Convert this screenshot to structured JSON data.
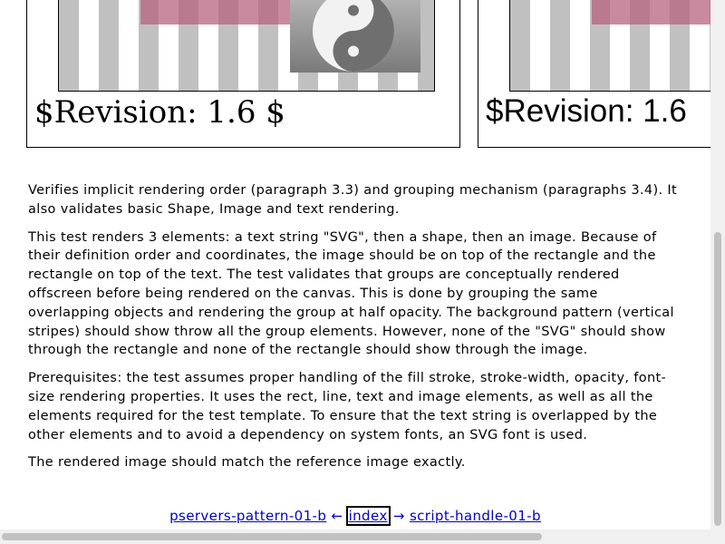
{
  "test_frames": {
    "left_revision": "$Revision: 1.6 $",
    "right_revision": "$Revision: 1.6"
  },
  "description": {
    "paragraphs": [
      "Verifies implicit rendering order (paragraph 3.3) and grouping mechanism (paragraphs 3.4). It also validates basic Shape, Image and text rendering.",
      "This test renders 3 elements: a text string \"SVG\", then a shape, then an image. Because of their definition order and coordinates, the image should be on top of the rectangle and the rectangle on top of the text. The test validates that groups are conceptually rendered offscreen before being rendered on the canvas. This is done by grouping the same overlapping objects and rendering the group at half opacity. The background pattern (vertical stripes) should show throw all the group elements. However, none of the \"SVG\" should show through the rectangle and none of the rectangle should show through the image.",
      "Prerequisites: the test assumes proper handling of the fill stroke, stroke-width, opacity, font-size rendering properties. It uses the rect, line, text and image elements, as well as all the elements required for the test template. To ensure that the text string is overlapped by the other elements and to avoid a dependency on system fonts, an SVG font is used.",
      "The rendered image should match the reference image exactly."
    ]
  },
  "nav": {
    "prev": "pservers-pattern-01-b",
    "left_arrow": "←",
    "index": "index",
    "right_arrow": "→",
    "next": "script-handle-01-b"
  },
  "colors": {
    "stripe": "#c0c0c0",
    "rect": "#b76380",
    "link": "#0000cc"
  }
}
